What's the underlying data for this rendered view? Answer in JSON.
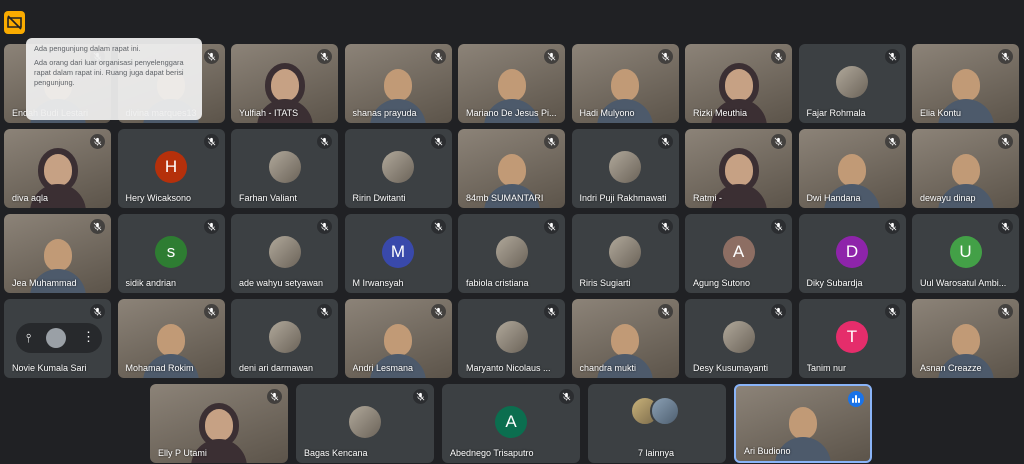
{
  "tooltip": {
    "line1": "Ada pengunjung dalam rapat ini.",
    "line2": "Ada orang dari luar organisasi penyelenggara rapat dalam rapat ini. Ruang juga dapat berisi pengunjung."
  },
  "participants": [
    {
      "name": "Endah Budi Lestari"
    },
    {
      "name": "divina marques13"
    },
    {
      "name": "Yulfiah - ITATS"
    },
    {
      "name": "shanas prayuda"
    },
    {
      "name": "Mariano De Jesus Pi..."
    },
    {
      "name": "Hadi Mulyono"
    },
    {
      "name": "Rizki Meuthia"
    },
    {
      "name": "Fajar Rohmala"
    },
    {
      "name": "Elia Kontu"
    },
    {
      "name": "diva aqla"
    },
    {
      "name": "Hery Wicaksono",
      "initial": "H"
    },
    {
      "name": "Farhan Valiant"
    },
    {
      "name": "Ririn Dwitanti"
    },
    {
      "name": "84mb SUMANTARI"
    },
    {
      "name": "Indri Puji Rakhmawati"
    },
    {
      "name": "Ratmi -"
    },
    {
      "name": "Dwi Handana"
    },
    {
      "name": "dewayu dinap"
    },
    {
      "name": "Jea Muhammad"
    },
    {
      "name": "sidik andrian",
      "initial": "s"
    },
    {
      "name": "ade wahyu setyawan"
    },
    {
      "name": "M Irwansyah",
      "initial": "M"
    },
    {
      "name": "fabiola cristiana"
    },
    {
      "name": "Riris Sugiarti"
    },
    {
      "name": "Agung Sutono",
      "initial": "A"
    },
    {
      "name": "Diky Subardja",
      "initial": "D"
    },
    {
      "name": "Uul Warosatul Ambi..."
    },
    {
      "name": "Novie Kumala Sari"
    },
    {
      "name": "Mohamad Rokim"
    },
    {
      "name": "deni ari darmawan"
    },
    {
      "name": "Andri Lesmana"
    },
    {
      "name": "Maryanto Nicolaus ..."
    },
    {
      "name": "chandra mukti"
    },
    {
      "name": "Desy Kusumayanti"
    },
    {
      "name": "Tanim nur",
      "initial": "T"
    },
    {
      "name": "Asnan Creazze"
    },
    {
      "name": "Elly P Utami"
    },
    {
      "name": "Bagas Kencana"
    },
    {
      "name": "Abednego Trisaputro",
      "initial": "A"
    },
    {
      "name": "7 lainnya"
    },
    {
      "name": "Ari Budiono"
    }
  ],
  "colors": {
    "background": "#202124",
    "tile": "#3c4043",
    "hery": "#b5300b",
    "sidik": "#2e7d32",
    "irwansyah": "#3949ab",
    "agung": "#8d6e63",
    "diky": "#8e24aa",
    "uul": "#43a047",
    "tanim": "#e52d6b",
    "abednego": "#0b6e4f",
    "accent": "#8ab4f8",
    "speaking": "#1a73e8"
  }
}
